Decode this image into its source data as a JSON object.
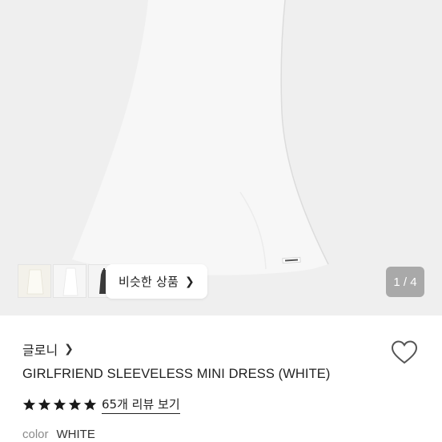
{
  "gallery": {
    "pager": "1 / 4",
    "similar_button_label": "비슷한 상품",
    "thumbnails": [
      "thumbnail-1",
      "thumbnail-2",
      "thumbnail-3"
    ]
  },
  "product": {
    "brand": "글로니",
    "title": "GIRLFRIEND SLEEVELESS MINI DRESS (WHITE)",
    "rating_stars": 5,
    "review_link": "65개 리뷰 보기",
    "color_label": "color",
    "color_value": "WHITE"
  },
  "colors": {
    "accent": "#222222",
    "pager_bg": "#a9a9a9",
    "hero_bg": "#efefef"
  }
}
